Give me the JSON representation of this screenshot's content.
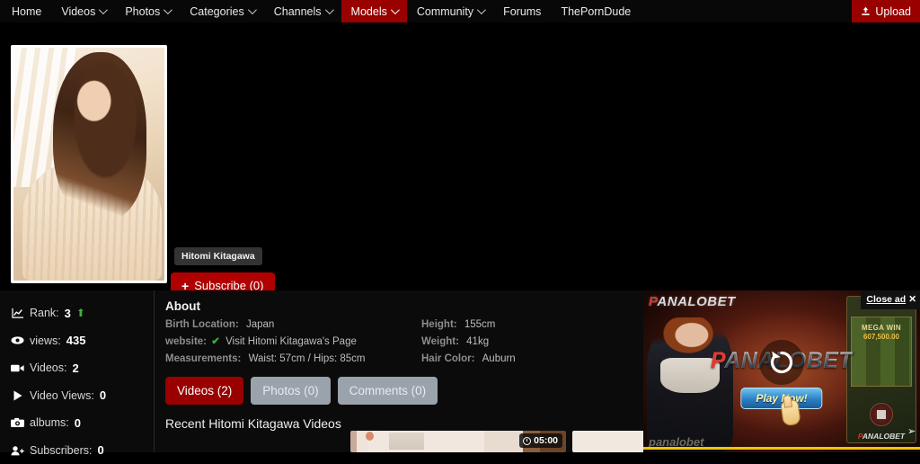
{
  "nav": {
    "items": [
      {
        "label": "Home",
        "caret": false,
        "active": false,
        "name": "nav-home"
      },
      {
        "label": "Videos",
        "caret": true,
        "active": false,
        "name": "nav-videos"
      },
      {
        "label": "Photos",
        "caret": true,
        "active": false,
        "name": "nav-photos"
      },
      {
        "label": "Categories",
        "caret": true,
        "active": false,
        "name": "nav-categories"
      },
      {
        "label": "Channels",
        "caret": true,
        "active": false,
        "name": "nav-channels"
      },
      {
        "label": "Models",
        "caret": true,
        "active": true,
        "name": "nav-models"
      },
      {
        "label": "Community",
        "caret": true,
        "active": false,
        "name": "nav-community"
      },
      {
        "label": "Forums",
        "caret": false,
        "active": false,
        "name": "nav-forums"
      },
      {
        "label": "ThePornDude",
        "caret": false,
        "active": false,
        "name": "nav-theporndude"
      }
    ],
    "upload_label": "Upload",
    "upload_icon": "upload-icon",
    "active_color": "#990000"
  },
  "profile": {
    "avatar_icon": "model-portrait",
    "name_badge": "Hitomi Kitagawa",
    "subscribe_label": "Subscribe (0)",
    "subscribe_plus": "+",
    "subscribe_color": "#b00000"
  },
  "stats": {
    "items": [
      {
        "icon": "chart-line-icon",
        "label": "Rank:",
        "value": "3",
        "trend": "⬆",
        "trend_color": "#3fae3f"
      },
      {
        "icon": "eye-icon",
        "label": "views:",
        "value": "435",
        "trend": ""
      },
      {
        "icon": "video-icon",
        "label": "Videos:",
        "value": "2",
        "trend": ""
      },
      {
        "icon": "play-icon",
        "label": "Video Views:",
        "value": "0",
        "trend": ""
      },
      {
        "icon": "camera-icon",
        "label": "albums:",
        "value": "0",
        "trend": ""
      },
      {
        "icon": "user-plus-icon",
        "label": "Subscribers:",
        "value": "0",
        "trend": ""
      }
    ]
  },
  "about": {
    "title": "About",
    "left": [
      {
        "key": "Birth Location:",
        "value": "Japan",
        "check": false
      },
      {
        "key": "website:",
        "value": "Visit Hitomi Kitagawa's Page",
        "check": true
      },
      {
        "key": "Measurements:",
        "value": "Waist: 57cm / Hips: 85cm",
        "check": false
      }
    ],
    "right": [
      {
        "key": "Height:",
        "value": "155cm"
      },
      {
        "key": "Weight:",
        "value": "41kg"
      },
      {
        "key": "Hair Color:",
        "value": "Auburn"
      }
    ],
    "check_glyph": "✔",
    "check_color": "#35b135"
  },
  "tabs": [
    {
      "label": "Videos (2)",
      "active": true,
      "name": "tab-videos"
    },
    {
      "label": "Photos (0)",
      "active": false,
      "name": "tab-photos"
    },
    {
      "label": "Comments (0)",
      "active": false,
      "name": "tab-comments"
    }
  ],
  "recent": {
    "heading": "Recent Hitomi Kitagawa Videos",
    "videos": [
      {
        "duration": "05:00",
        "thumb": "video-thumbnail-1"
      },
      {
        "duration": "",
        "thumb": "video-thumbnail-2"
      }
    ]
  },
  "ad": {
    "brand_top_red": "P",
    "brand_top_rest": "ANALOBET",
    "brand_center_red": "P",
    "brand_center_rest": "ANALOBET",
    "play_label": "Play Now!",
    "slot_title": "MEGA WIN",
    "slot_sub": "607,500.00",
    "slot_logo_red": "P",
    "slot_logo_rest": "ANALOBET",
    "bottom_logo": "panalobet",
    "close_label": "Close ad",
    "close_x": "✕",
    "replay_icon": "replay-icon",
    "progress_color": "#f2c500"
  }
}
